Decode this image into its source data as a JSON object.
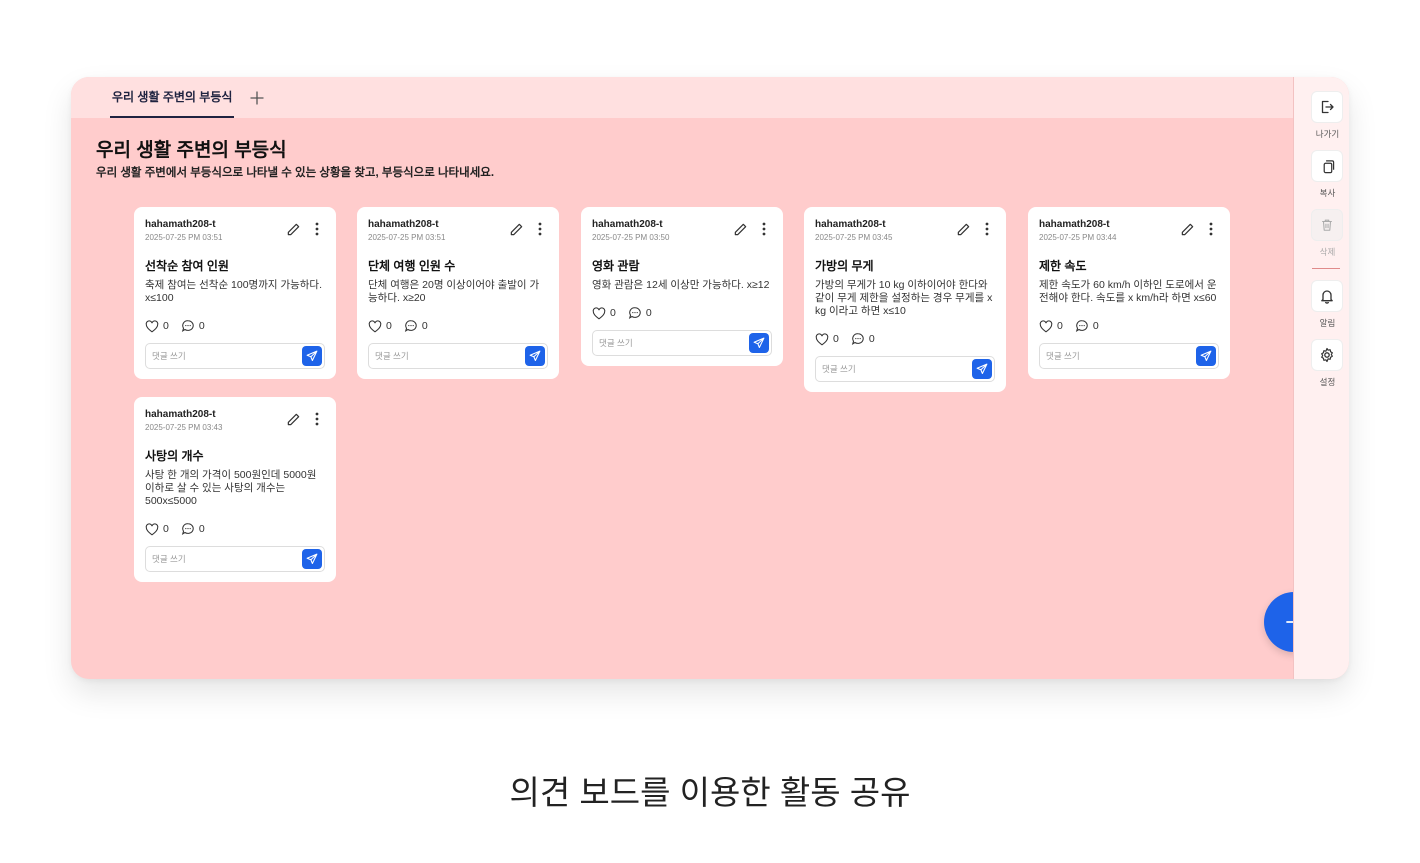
{
  "tabs": [
    {
      "label": "우리 생활 주변의 부등식"
    }
  ],
  "board": {
    "title": "우리 생활 주변의 부등식",
    "description": "우리 생활 주변에서 부등식으로 나타낼 수 있는 상황을 찾고, 부등식으로 나타내세요."
  },
  "cards": [
    {
      "author": "hahamath208-t",
      "date": "2025-07-25 PM 03:51",
      "title": "선착순 참여 인원",
      "body": "축제 참여는 선착순 100명까지 가능하다. x≤100",
      "likes": "0",
      "comments": "0",
      "placeholder": "댓글 쓰기"
    },
    {
      "author": "hahamath208-t",
      "date": "2025-07-25 PM 03:51",
      "title": "단체 여행 인원 수",
      "body": "단체 여행은 20명 이상이어야 출발이 가능하다. x≥20",
      "likes": "0",
      "comments": "0",
      "placeholder": "댓글 쓰기"
    },
    {
      "author": "hahamath208-t",
      "date": "2025-07-25 PM 03:50",
      "title": "영화 관람",
      "body": "영화 관람은 12세 이상만 가능하다. x≥12",
      "likes": "0",
      "comments": "0",
      "placeholder": "댓글 쓰기"
    },
    {
      "author": "hahamath208-t",
      "date": "2025-07-25 PM 03:45",
      "title": "가방의 무게",
      "body": "가방의 무게가 10 kg 이하이어야 한다와 같이 무게 제한을 설정하는 경우 무게를 x kg 이라고 하면 x≤10",
      "likes": "0",
      "comments": "0",
      "placeholder": "댓글 쓰기"
    },
    {
      "author": "hahamath208-t",
      "date": "2025-07-25 PM 03:44",
      "title": "제한 속도",
      "body": "제한 속도가 60 km/h 이하인 도로에서 운전해야 한다. 속도를 x km/h라 하면 x≤60",
      "likes": "0",
      "comments": "0",
      "placeholder": "댓글 쓰기"
    },
    {
      "author": "hahamath208-t",
      "date": "2025-07-25 PM 03:43",
      "title": "사탕의 개수",
      "body": "사탕 한 개의 가격이 500원인데 5000원 이하로 살 수 있는 사탕의 개수는 500x≤5000",
      "likes": "0",
      "comments": "0",
      "placeholder": "댓글 쓰기"
    }
  ],
  "sidebar": {
    "exit": "나가기",
    "copy": "복사",
    "delete": "삭제",
    "alarm": "알림",
    "settings": "설정"
  },
  "colors": {
    "background": "#ffcccc",
    "tabbar": "#ffe0e0",
    "accent": "#1e63e9"
  },
  "icons": [
    "exit-icon",
    "copy-icon",
    "trash-icon",
    "bell-icon",
    "gear-icon",
    "pencil-icon",
    "more-icon",
    "heart-icon",
    "comment-icon",
    "send-icon",
    "plus-icon"
  ],
  "caption": "의견 보드를 이용한 활동 공유"
}
